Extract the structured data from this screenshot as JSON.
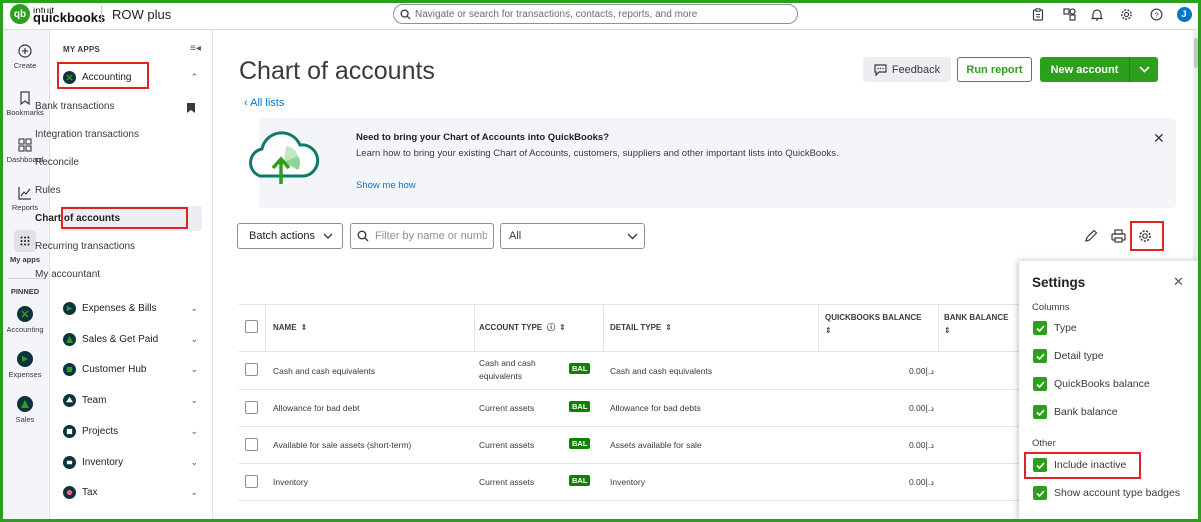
{
  "topbar": {
    "logo_line1": "intuit",
    "logo_line2": "quickbooks",
    "company": "ROW plus",
    "search_placeholder": "Navigate or search for transactions, contacts, reports, and more",
    "avatar_initial": "J"
  },
  "rail": {
    "items": [
      {
        "label": "Create"
      },
      {
        "label": "Bookmarks"
      },
      {
        "label": "Dashboard"
      },
      {
        "label": "Reports"
      },
      {
        "label": "My apps"
      }
    ],
    "pinned_label": "PINNED",
    "pinned": [
      {
        "label": "Accounting"
      },
      {
        "label": "Expenses"
      },
      {
        "label": "Sales"
      }
    ]
  },
  "sidebar": {
    "header": "MY APPS",
    "accounting_label": "Accounting",
    "sub_items": [
      {
        "label": "Bank transactions"
      },
      {
        "label": "Integration transactions"
      },
      {
        "label": "Reconcile"
      },
      {
        "label": "Rules"
      },
      {
        "label": "Chart of accounts"
      },
      {
        "label": "Recurring transactions"
      },
      {
        "label": "My accountant"
      }
    ],
    "apps": [
      {
        "label": "Expenses & Bills"
      },
      {
        "label": "Sales & Get Paid"
      },
      {
        "label": "Customer Hub"
      },
      {
        "label": "Team"
      },
      {
        "label": "Projects"
      },
      {
        "label": "Inventory"
      },
      {
        "label": "Tax"
      }
    ]
  },
  "main": {
    "title": "Chart of accounts",
    "all_lists": "All lists",
    "feedback": "Feedback",
    "run_report": "Run report",
    "new_account": "New account",
    "banner_title": "Need to bring your Chart of Accounts into QuickBooks?",
    "banner_text": "Learn how to bring your existing Chart of Accounts, customers, suppliers and other important lists into QuickBooks.",
    "banner_link": "Show me how",
    "batch_actions": "Batch actions",
    "filter_placeholder": "Filter by name or number",
    "type_filter": "All"
  },
  "table": {
    "headers": {
      "name": "NAME",
      "account_type": "ACCOUNT TYPE",
      "detail_type": "DETAIL TYPE",
      "qb_balance": "QUICKBOOKS BALANCE",
      "bank_balance": "BANK BALANCE"
    },
    "badge": "BAL",
    "rows": [
      {
        "name": "Cash and cash equivalents",
        "type_line1": "Cash and cash",
        "type_line2": "equivalents",
        "detail": "Cash and cash equivalents",
        "balance": "0.00د.إ"
      },
      {
        "name": "Allowance for bad debt",
        "type_line1": "Current assets",
        "type_line2": "",
        "detail": "Allowance for bad debts",
        "balance": "0.00د.إ"
      },
      {
        "name": "Available for sale assets (short-term)",
        "type_line1": "Current assets",
        "type_line2": "",
        "detail": "Assets available for sale",
        "balance": "0.00د.إ"
      },
      {
        "name": "Inventory",
        "type_line1": "Current assets",
        "type_line2": "",
        "detail": "Inventory",
        "balance": "0.00د.إ"
      }
    ]
  },
  "settings": {
    "title": "Settings",
    "columns_label": "Columns",
    "columns": [
      {
        "label": "Type",
        "checked": true
      },
      {
        "label": "Detail type",
        "checked": true
      },
      {
        "label": "QuickBooks balance",
        "checked": true
      },
      {
        "label": "Bank balance",
        "checked": true
      }
    ],
    "other_label": "Other",
    "other": [
      {
        "label": "Include inactive",
        "checked": true
      },
      {
        "label": "Show account type badges",
        "checked": true
      }
    ]
  },
  "colors": {
    "brand_green": "#2ca01c",
    "highlight_red": "#e02424",
    "link_blue": "#0077c5",
    "badge_green": "#108000"
  }
}
